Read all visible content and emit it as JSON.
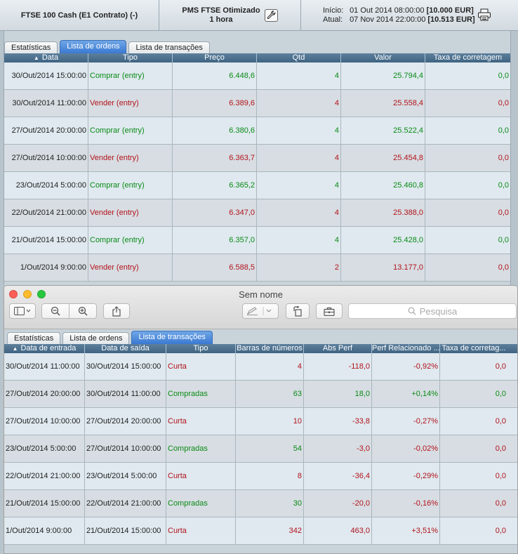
{
  "header": {
    "instrument": "FTSE 100 Cash (E1 Contrato) (-)",
    "strategy_line1": "PMS FTSE Otimizado",
    "strategy_line2": "1 hora",
    "start_label": "Início:",
    "start_value": "01 Out 2014 08:00:00",
    "start_amount": "[10.000 EUR]",
    "current_label": "Atual:",
    "current_value": "07 Nov 2014 22:00:00",
    "current_amount": "[10.513 EUR]",
    "icons": {
      "settings": "wrench-icon",
      "print": "printer-icon"
    }
  },
  "panel1": {
    "tabs": [
      "Estatísticas",
      "Lista de ordens",
      "Lista de transações"
    ],
    "active_tab": "Lista de ordens",
    "columns": [
      "Data",
      "Tipo",
      "Preço",
      "Qtd",
      "Valor",
      "Taxa de corretagem"
    ],
    "rows": [
      {
        "date": "30/Out/2014 15:00:00",
        "type": "Comprar (entry)",
        "price": "6.448,6",
        "qty": "4",
        "value": "25.794,4",
        "fee": "0,0",
        "color": "green"
      },
      {
        "date": "30/Out/2014 11:00:00",
        "type": "Vender (entry)",
        "price": "6.389,6",
        "qty": "4",
        "value": "25.558,4",
        "fee": "0,0",
        "color": "red"
      },
      {
        "date": "27/Out/2014 20:00:00",
        "type": "Comprar (entry)",
        "price": "6.380,6",
        "qty": "4",
        "value": "25.522,4",
        "fee": "0,0",
        "color": "green"
      },
      {
        "date": "27/Out/2014 10:00:00",
        "type": "Vender (entry)",
        "price": "6.363,7",
        "qty": "4",
        "value": "25.454,8",
        "fee": "0,0",
        "color": "red"
      },
      {
        "date": "23/Out/2014 5:00:00",
        "type": "Comprar (entry)",
        "price": "6.365,2",
        "qty": "4",
        "value": "25.460,8",
        "fee": "0,0",
        "color": "green"
      },
      {
        "date": "22/Out/2014 21:00:00",
        "type": "Vender (entry)",
        "price": "6.347,0",
        "qty": "4",
        "value": "25.388,0",
        "fee": "0,0",
        "color": "red"
      },
      {
        "date": "21/Out/2014 15:00:00",
        "type": "Comprar (entry)",
        "price": "6.357,0",
        "qty": "4",
        "value": "25.428,0",
        "fee": "0,0",
        "color": "green"
      },
      {
        "date": "1/Out/2014 9:00:00",
        "type": "Vender (entry)",
        "price": "6.588,5",
        "qty": "2",
        "value": "13.177,0",
        "fee": "0,0",
        "color": "red"
      }
    ]
  },
  "window": {
    "title": "Sem nome",
    "search_placeholder": "Pesquisa",
    "toolbar_icons": [
      "sidebar-icon",
      "zoom-out-icon",
      "zoom-in-icon",
      "share-icon",
      "markup-icon",
      "rotate-icon",
      "toolbox-icon"
    ]
  },
  "panel2": {
    "tabs": [
      "Estatísticas",
      "Lista de ordens",
      "Lista de transações"
    ],
    "active_tab": "Lista de transações",
    "columns": [
      "Data de entrada",
      "Data de saída",
      "Tipo",
      "Barras de números",
      "Abs Perf",
      "Perf Relacionado ...",
      "Taxa de corretag..."
    ],
    "rows": [
      {
        "entry": "30/Out/2014 11:00:00",
        "exit": "30/Out/2014 15:00:00",
        "type": "Curta",
        "bars": "4",
        "abs": "-118,0",
        "rel": "-0,92%",
        "fee": "0,0",
        "type_color": "red",
        "perf_color": "red"
      },
      {
        "entry": "27/Out/2014 20:00:00",
        "exit": "30/Out/2014 11:00:00",
        "type": "Compradas",
        "bars": "63",
        "abs": "18,0",
        "rel": "+0,14%",
        "fee": "0,0",
        "type_color": "green",
        "perf_color": "green"
      },
      {
        "entry": "27/Out/2014 10:00:00",
        "exit": "27/Out/2014 20:00:00",
        "type": "Curta",
        "bars": "10",
        "abs": "-33,8",
        "rel": "-0,27%",
        "fee": "0,0",
        "type_color": "red",
        "perf_color": "red"
      },
      {
        "entry": "23/Out/2014 5:00:00",
        "exit": "27/Out/2014 10:00:00",
        "type": "Compradas",
        "bars": "54",
        "abs": "-3,0",
        "rel": "-0,02%",
        "fee": "0,0",
        "type_color": "green",
        "perf_color": "red"
      },
      {
        "entry": "22/Out/2014 21:00:00",
        "exit": "23/Out/2014 5:00:00",
        "type": "Curta",
        "bars": "8",
        "abs": "-36,4",
        "rel": "-0,29%",
        "fee": "0,0",
        "type_color": "red",
        "perf_color": "red"
      },
      {
        "entry": "21/Out/2014 15:00:00",
        "exit": "22/Out/2014 21:00:00",
        "type": "Compradas",
        "bars": "30",
        "abs": "-20,0",
        "rel": "-0,16%",
        "fee": "0,0",
        "type_color": "green",
        "perf_color": "red"
      },
      {
        "entry": "1/Out/2014 9:00:00",
        "exit": "21/Out/2014 15:00:00",
        "type": "Curta",
        "bars": "342",
        "abs": "463,0",
        "rel": "+3,51%",
        "fee": "0,0",
        "type_color": "red",
        "perf_color": "red"
      }
    ]
  },
  "colors": {
    "positive": "#0a8a16",
    "negative": "#b3121c",
    "active_tab": "#3a79d2",
    "table_header": "#4a6e8d"
  }
}
